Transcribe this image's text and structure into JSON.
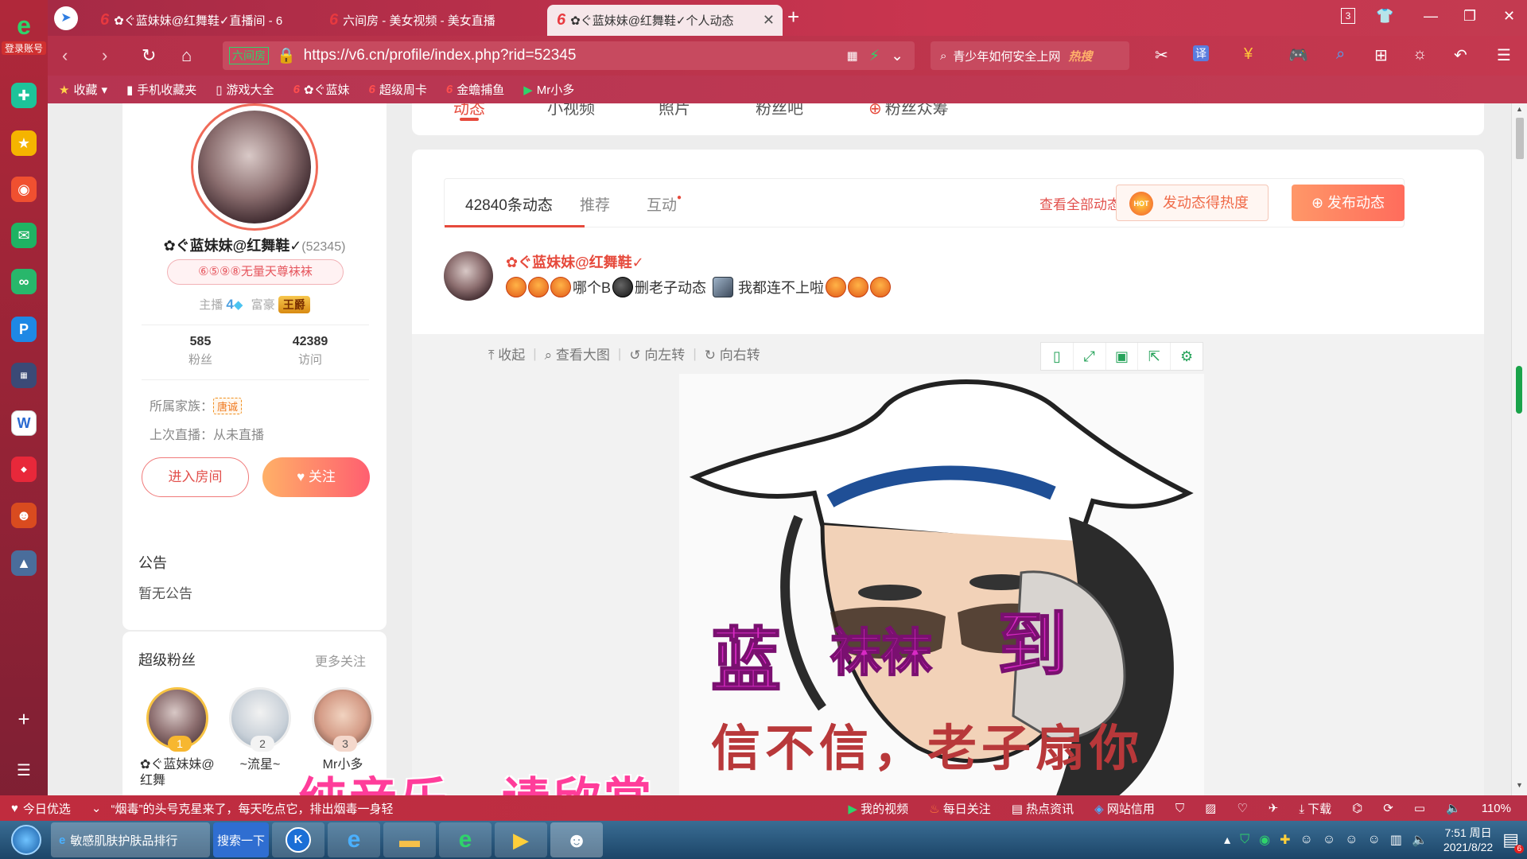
{
  "sidebar": {
    "account_label": "登录账号"
  },
  "tabs": [
    {
      "label": "✿ぐ蓝妹妹@红舞鞋✓直播间 - 6"
    },
    {
      "label": "六间房 - 美女视频 - 美女直播"
    },
    {
      "label": "✿ぐ蓝妹妹@红舞鞋✓个人动态"
    }
  ],
  "window": {
    "tab_count": "3"
  },
  "address": {
    "site_label": "六间房",
    "url": "https://v6.cn/profile/index.php?rid=52345",
    "search_text": "青少年如何安全上网",
    "search_badge": "热搜"
  },
  "bookmarks": [
    {
      "label": "收藏"
    },
    {
      "label": "手机收藏夹"
    },
    {
      "label": "游戏大全"
    },
    {
      "label": "✿ぐ蓝妹"
    },
    {
      "label": "超级周卡"
    },
    {
      "label": "金蟾捕鱼"
    },
    {
      "label": "Mr小多"
    }
  ],
  "topnav": [
    {
      "label": "动态"
    },
    {
      "label": "小视频"
    },
    {
      "label": "照片"
    },
    {
      "label": "粉丝吧"
    },
    {
      "label": "粉丝众筹"
    }
  ],
  "profile": {
    "name": "✿ぐ蓝妹妹@红舞鞋✓",
    "rid": "(52345)",
    "title": "⑥⑤⑨⑧无量天尊袜袜",
    "anchor_label": "主播",
    "anchor_level": "4",
    "rich_label": "富豪",
    "rich_badge": "王爵",
    "fans_count": "585",
    "fans_label": "粉丝",
    "visits_count": "42389",
    "visits_label": "访问",
    "family_label": "所属家族：",
    "family_tag": "唐诚",
    "last_live": "上次直播：从未直播",
    "enter_room": "进入房间",
    "follow": "关注"
  },
  "notice": {
    "title": "公告",
    "body": "暂无公告"
  },
  "superfans": {
    "title": "超级粉丝",
    "more": "更多关注",
    "fans": [
      {
        "rank": "1",
        "name": "✿ぐ蓝妹妹@红舞"
      },
      {
        "rank": "2",
        "name": "~流星~"
      },
      {
        "rank": "3",
        "name": "Mr小多"
      }
    ]
  },
  "feed": {
    "tabs": [
      {
        "label": "42840条动态"
      },
      {
        "label": "推荐"
      },
      {
        "label": "互动"
      }
    ],
    "view_all": "查看全部动态",
    "hot_button": "发动态得热度",
    "hot_badge": "HOT",
    "post_button": "发布动态",
    "post": {
      "author": "✿ぐ蓝妹妹@红舞鞋✓",
      "text_part1": "哪个B",
      "text_part2": "删老子动态",
      "text_part3": "我都连不上啦"
    },
    "image_tools": [
      {
        "label": "收起"
      },
      {
        "label": "查看大图"
      },
      {
        "label": "向左转"
      },
      {
        "label": "向右转"
      }
    ],
    "meme": {
      "line1_left": "蓝",
      "line1_mid": "袜袜",
      "line1_right": "到",
      "line2": "信不信，老子扇你"
    }
  },
  "overlay_caption": "纯音乐，请欣赏",
  "statusbar": {
    "left": "今日优选",
    "news": "“烟毒”的头号克星来了，每天吃点它，排出烟毒一身轻",
    "items": [
      {
        "label": "我的视频"
      },
      {
        "label": "每日关注"
      },
      {
        "label": "热点资讯"
      },
      {
        "label": "网站信用"
      },
      {
        "label": "下载"
      }
    ],
    "zoom": "110%"
  },
  "taskbar": {
    "ie_tab": "敏感肌肤护肤品排行",
    "search_btn": "搜索一下",
    "time": "7:51 周日",
    "date": "2021/8/22",
    "notif_count": "6"
  }
}
